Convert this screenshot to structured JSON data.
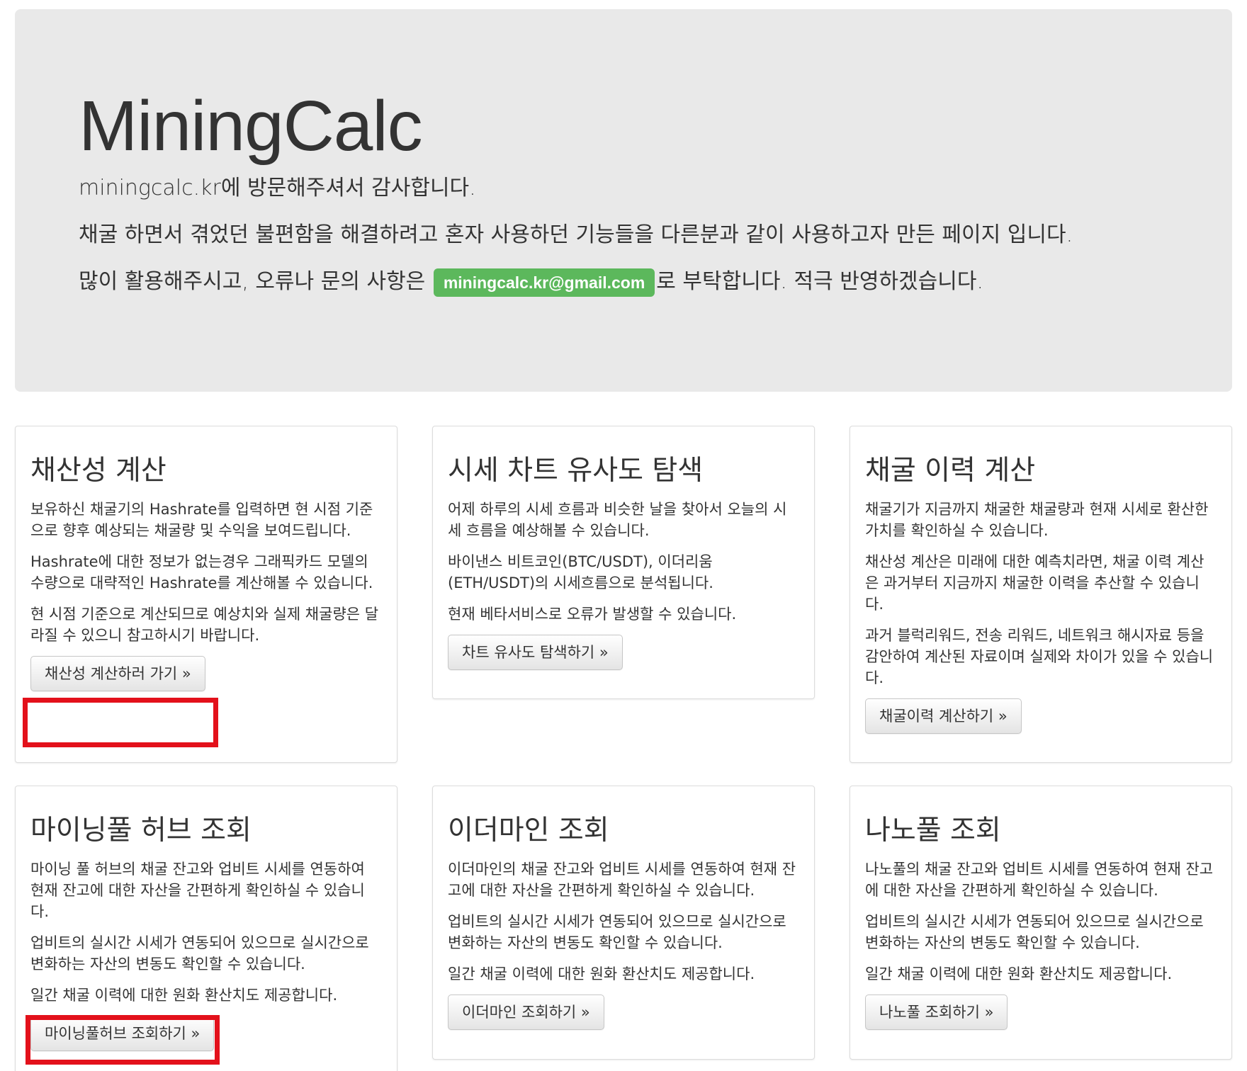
{
  "jumbotron": {
    "title": "MiningCalc",
    "lead": "miningcalc.kr에 방문해주셔서 감사합니다.",
    "description": "채굴 하면서 겪었던 불편함을 해결하려고 혼자 사용하던 기능들을 다른분과 같이 사용하고자 만든 페이지 입니다.",
    "contact_prefix": "많이 활용해주시고, 오류나 문의 사항은 ",
    "email": "miningcalc.kr@gmail.com",
    "contact_suffix": "로 부탁합니다. 적극 반영하겠습니다.",
    "email_badge_color": "#5cb85c"
  },
  "cards": [
    {
      "title": "채산성 계산",
      "paragraphs": [
        "보유하신 채굴기의 Hashrate를 입력하면 현 시점 기준으로 향후 예상되는 채굴량 및 수익을 보여드립니다.",
        "Hashrate에 대한 정보가 없는경우 그래픽카드 모델의 수량으로 대략적인 Hashrate를 계산해볼 수 있습니다.",
        "현 시점 기준으로 계산되므로 예상치와 실제 채굴량은 달라질 수 있으니 참고하시기 바랍니다."
      ],
      "button": "채산성 계산하러 가기 »"
    },
    {
      "title": "시세 차트 유사도 탐색",
      "paragraphs": [
        "어제 하루의 시세 흐름과 비슷한 날을 찾아서 오늘의 시세 흐름을 예상해볼 수 있습니다.",
        "바이낸스 비트코인(BTC/USDT), 이더리움(ETH/USDT)의 시세흐름으로 분석됩니다.",
        "현재 베타서비스로 오류가 발생할 수 있습니다."
      ],
      "button": "차트 유사도 탐색하기 »"
    },
    {
      "title": "채굴 이력 계산",
      "paragraphs": [
        "채굴기가 지금까지 채굴한 채굴량과 현재 시세로 환산한 가치를 확인하실 수 있습니다.",
        "채산성 계산은 미래에 대한 예측치라면, 채굴 이력 계산은 과거부터 지금까지 채굴한 이력을 추산할 수 있습니다.",
        "과거 블럭리워드, 전송 리워드, 네트워크 해시자료 등을 감안하여 계산된 자료이며 실제와 차이가 있을 수 있습니다."
      ],
      "button": "채굴이력 계산하기 »"
    },
    {
      "title": "마이닝풀 허브 조회",
      "paragraphs": [
        "마이닝 풀 허브의 채굴 잔고와 업비트 시세를 연동하여 현재 잔고에 대한 자산을 간편하게 확인하실 수 있습니다.",
        "업비트의 실시간 시세가 연동되어 있으므로 실시간으로 변화하는 자산의 변동도 확인할 수 있습니다.",
        "일간 채굴 이력에 대한 원화 환산치도 제공합니다."
      ],
      "button": "마이닝풀허브 조회하기 »"
    },
    {
      "title": "이더마인 조회",
      "paragraphs": [
        "이더마인의 채굴 잔고와 업비트 시세를 연동하여 현재 잔고에 대한 자산을 간편하게 확인하실 수 있습니다.",
        "업비트의 실시간 시세가 연동되어 있으므로 실시간으로 변화하는 자산의 변동도 확인할 수 있습니다.",
        "일간 채굴 이력에 대한 원화 환산치도 제공합니다."
      ],
      "button": "이더마인 조회하기 »"
    },
    {
      "title": "나노풀 조회",
      "paragraphs": [
        "나노풀의 채굴 잔고와 업비트 시세를 연동하여 현재 잔고에 대한 자산을 간편하게 확인하실 수 있습니다.",
        "업비트의 실시간 시세가 연동되어 있으므로 실시간으로 변화하는 자산의 변동도 확인할 수 있습니다.",
        "일간 채굴 이력에 대한 원화 환산치도 제공합니다."
      ],
      "button": "나노풀 조회하기 »"
    }
  ],
  "highlight_color": "#e3111b"
}
